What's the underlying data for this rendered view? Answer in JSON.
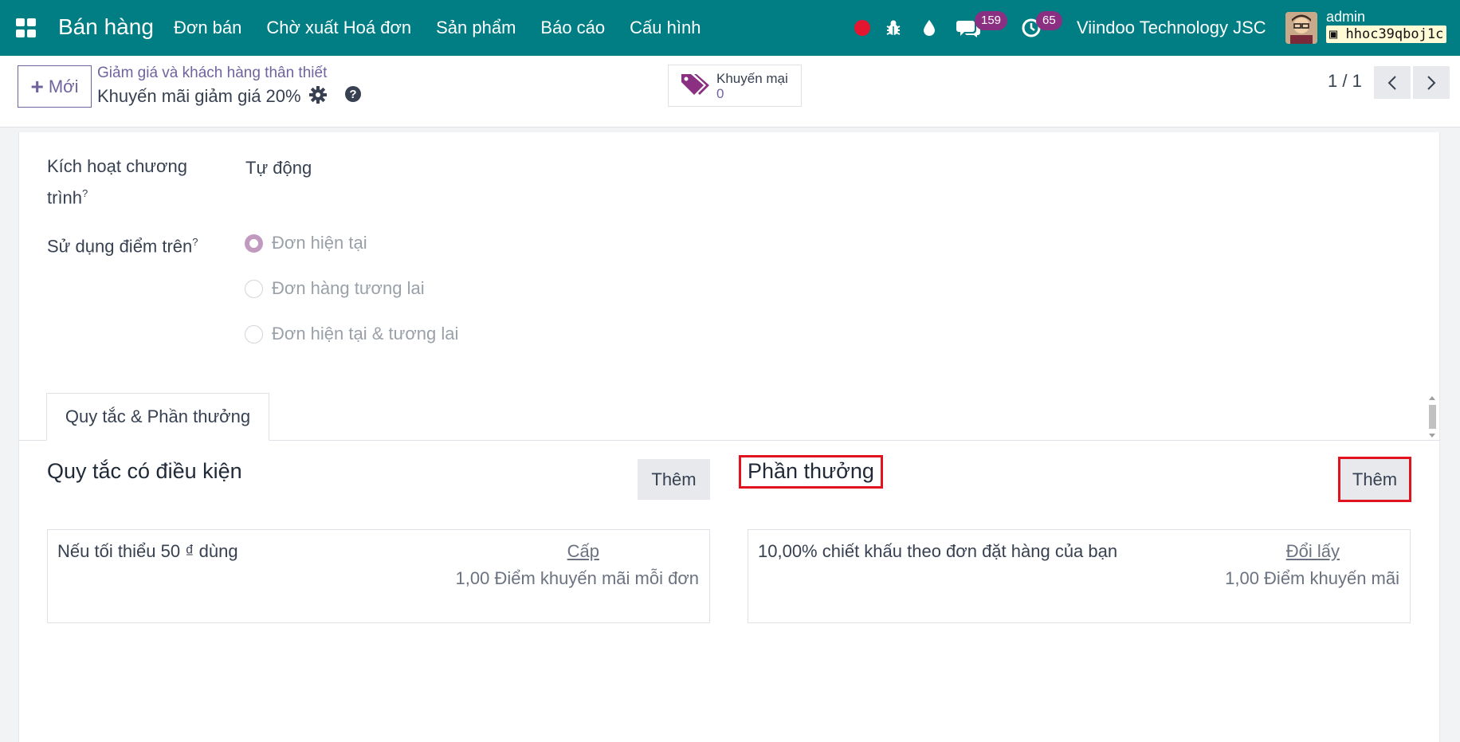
{
  "navbar": {
    "app_name": "Bán hàng",
    "menu": [
      "Đơn bán",
      "Chờ xuất Hoá đơn",
      "Sản phẩm",
      "Báo cáo",
      "Cấu hình"
    ],
    "chat_count": "159",
    "activity_count": "65",
    "company": "Viindoo Technology JSC",
    "user": "admin",
    "database": "hhoc39qboj1c"
  },
  "control": {
    "new_label": "Mới",
    "breadcrumb": "Giảm giá và khách hàng thân thiết",
    "record_title": "Khuyến mãi giảm giá 20%",
    "promo_label": "Khuyến mại",
    "promo_count": "0",
    "pager": "1 / 1"
  },
  "form": {
    "trigger_label_1": "Kích hoạt chương",
    "trigger_label_2": "trình",
    "trigger_value": "Tự động",
    "points_label": "Sử dụng điểm trên",
    "help_mark": "?",
    "points_options": [
      "Đơn hiện tại",
      "Đơn hàng tương lai",
      "Đơn hiện tại & tương lai"
    ],
    "tab_label": "Quy tắc & Phần thưởng",
    "rules": {
      "title": "Quy tắc có điều kiện",
      "add_label": "Thêm",
      "card_text": "Nếu tối thiểu 50 ₫ dùng",
      "card_link": "Cấp",
      "card_sub": "1,00 Điểm khuyến mãi mỗi đơn"
    },
    "rewards": {
      "title": "Phần thưởng",
      "add_label": "Thêm",
      "card_text": "10,00% chiết khấu theo đơn đặt hàng của bạn",
      "card_link": "Đổi lấy",
      "card_sub": "1,00 Điểm khuyến mãi"
    }
  },
  "colors": {
    "navbar": "#017e84",
    "accent": "#71639e",
    "highlight": "#e0131f",
    "badge": "#8a2f82"
  }
}
